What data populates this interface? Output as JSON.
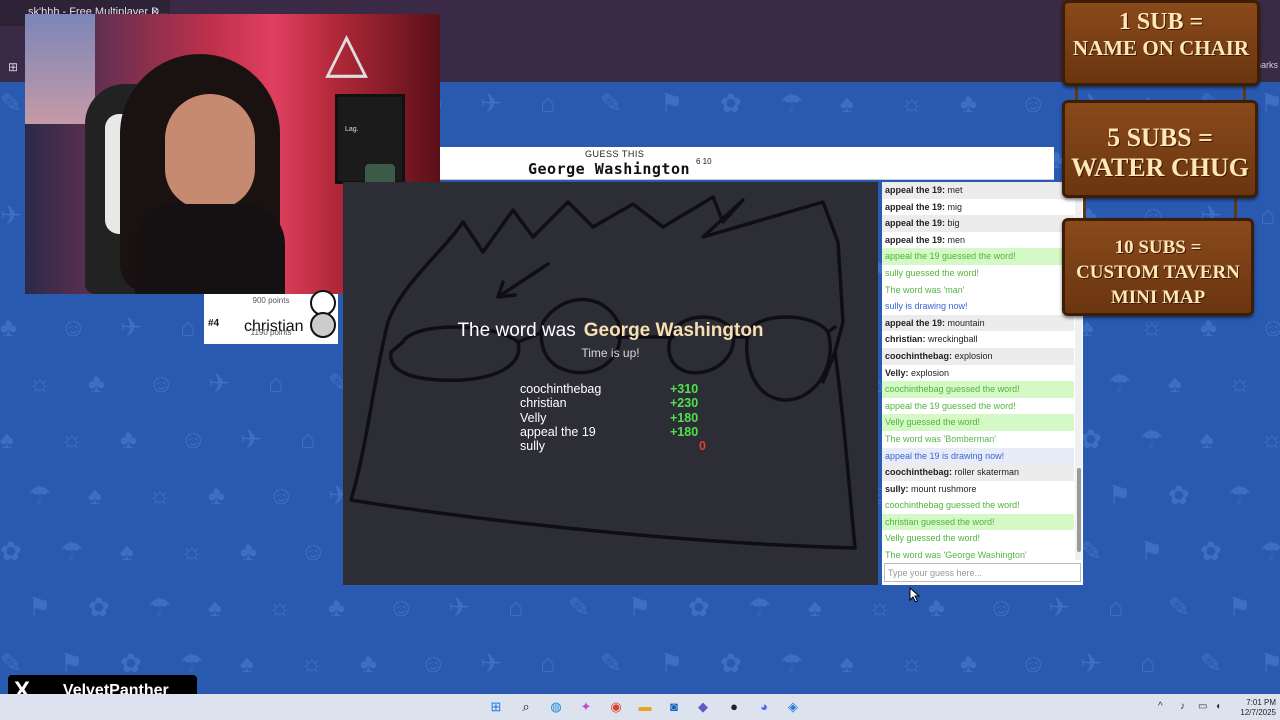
{
  "browser": {
    "tab_title": "sk'hhh - Free Multiplayer D...",
    "tab_close": "×",
    "bookmarks_label": "marks"
  },
  "webcam": {
    "frame_text": "Lag."
  },
  "players": [
    {
      "rank": "",
      "name": "",
      "points": "900 points"
    },
    {
      "rank": "#4",
      "name": "christian",
      "points": "1190 points"
    }
  ],
  "header": {
    "guess_label": "GUESS THIS",
    "word": "George Washington",
    "hint": "6 10"
  },
  "overlay": {
    "title_prefix": "The word was",
    "title_word": "George Washington",
    "subtitle": "Time is up!",
    "scores": [
      {
        "name": "coochinthebag",
        "points": "+310"
      },
      {
        "name": "christian",
        "points": "+230"
      },
      {
        "name": "Velly",
        "points": "+180"
      },
      {
        "name": "appeal the 19",
        "points": "+180"
      },
      {
        "name": "sully",
        "points": "0"
      }
    ]
  },
  "chat": {
    "messages": [
      {
        "type": "chat",
        "user": "appeal the 19:",
        "text": "met"
      },
      {
        "type": "chat",
        "user": "appeal the 19:",
        "text": "mig"
      },
      {
        "type": "chat",
        "user": "appeal the 19:",
        "text": "big"
      },
      {
        "type": "chat",
        "user": "appeal the 19:",
        "text": "men"
      },
      {
        "type": "guessed",
        "text": "appeal the 19 guessed the word!"
      },
      {
        "type": "guessed",
        "text": "sully guessed the word!"
      },
      {
        "type": "word",
        "text": "The word was 'man'"
      },
      {
        "type": "drawing",
        "text": "sully is drawing now!"
      },
      {
        "type": "chat",
        "user": "appeal the 19:",
        "text": "mountain"
      },
      {
        "type": "chat",
        "user": "christian:",
        "text": "wreckingball"
      },
      {
        "type": "chat",
        "user": "coochinthebag:",
        "text": "explosion"
      },
      {
        "type": "chat",
        "user": "Velly:",
        "text": "explosion"
      },
      {
        "type": "guessed",
        "text": "coochinthebag guessed the word!"
      },
      {
        "type": "guessed",
        "text": "appeal the 19 guessed the word!"
      },
      {
        "type": "guessed",
        "text": "Velly guessed the word!"
      },
      {
        "type": "word",
        "text": "The word was 'Bomberman'"
      },
      {
        "type": "drawing",
        "text": "appeal the 19 is drawing now!"
      },
      {
        "type": "chat",
        "user": "coochinthebag:",
        "text": "roller skaterman"
      },
      {
        "type": "chat",
        "user": "sully:",
        "text": "mount rushmore"
      },
      {
        "type": "guessed",
        "text": "coochinthebag guessed the word!"
      },
      {
        "type": "guessed",
        "text": "christian guessed the word!"
      },
      {
        "type": "guessed",
        "text": "Velly guessed the word!"
      },
      {
        "type": "word",
        "text": "The word was 'George Washington'"
      }
    ],
    "input_placeholder": "Type your guess here..."
  },
  "signs": [
    {
      "line1": "1 SUB =",
      "line2": "NAME ON CHAIR"
    },
    {
      "line1": "5 SUBS =",
      "line2": "WATER CHUG"
    },
    {
      "line1": "10 SUBS =",
      "line2": "CUSTOM TAVERN",
      "line3": "MINI MAP"
    }
  ],
  "social": {
    "logo": "X",
    "handle": "_VelvetPanther"
  },
  "taskbar": {
    "time": "7:01 PM",
    "date": "12/7/2025",
    "icons": [
      "windows-start",
      "search",
      "edge",
      "copilot",
      "chrome",
      "file-explorer",
      "outlook",
      "teams",
      "obs",
      "discord",
      "app"
    ]
  },
  "colors": {
    "page_bg": "#2a5ab0",
    "canvas_bg": "#2d2d35",
    "correct_green": "#4fb638",
    "drawing_blue": "#3a63d8",
    "score_green": "#4ee34e",
    "score_red": "#e23b3b",
    "sign_wood": "#7a4015"
  }
}
